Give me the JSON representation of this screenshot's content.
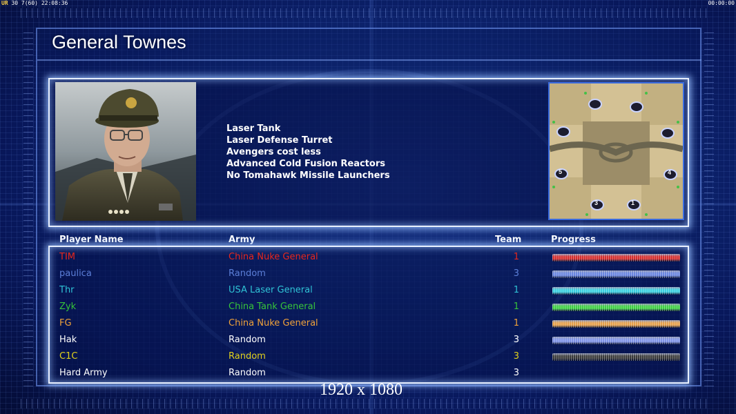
{
  "hud": {
    "left_label": "UR",
    "left_stats": "30 7(60) 22:08:36",
    "right_clock": "00:00:00"
  },
  "general": {
    "title": "General Townes",
    "features": [
      "Laser Tank",
      "Laser Defense Turret",
      "Avengers cost less",
      "Advanced Cold Fusion Reactors",
      "No Tomahawk Missile Launchers"
    ]
  },
  "minimap": {
    "start_positions": [
      "5",
      "4",
      "3",
      "1"
    ]
  },
  "table": {
    "headers": {
      "player_name": "Player Name",
      "army": "Army",
      "team": "Team",
      "progress": "Progress"
    },
    "rows": [
      {
        "name": "TIM",
        "army": "China Nuke General",
        "team": "1",
        "color": "#e8271c",
        "army_color": "#e8271c",
        "team_color": "#e8271c",
        "bar_color": "#d62d2d",
        "has_bar": true
      },
      {
        "name": "paulica",
        "army": "Random",
        "team": "3",
        "color": "#5c7fd8",
        "army_color": "#5c7fd8",
        "team_color": "#5c7fd8",
        "bar_color": "#6a86e0",
        "has_bar": true
      },
      {
        "name": "Thr",
        "army": "USA Laser General",
        "team": "1",
        "color": "#2fc3d6",
        "army_color": "#2fc3d6",
        "team_color": "#2fc3d6",
        "bar_color": "#3ad0e0",
        "has_bar": true
      },
      {
        "name": "Zyk",
        "army": "China Tank General",
        "team": "1",
        "color": "#37c53a",
        "army_color": "#37c53a",
        "team_color": "#37c53a",
        "bar_color": "#3fd043",
        "has_bar": true
      },
      {
        "name": "FG",
        "army": "China Nuke General",
        "team": "1",
        "color": "#f0a23a",
        "army_color": "#f0a23a",
        "team_color": "#f0a23a",
        "bar_color": "#e6a04a",
        "has_bar": true
      },
      {
        "name": "Hak",
        "army": "Random",
        "team": "3",
        "color": "#ffffff",
        "army_color": "#ffffff",
        "team_color": "#ffffff",
        "bar_color": "#7f93e8",
        "has_bar": true
      },
      {
        "name": "C1C",
        "army": "Random",
        "team": "3",
        "color": "#e2d21c",
        "army_color": "#e2d21c",
        "team_color": "#e2d21c",
        "bar_color": "#3a3a3a",
        "has_bar": true
      },
      {
        "name": "Hard Army",
        "army": "Random",
        "team": "3",
        "color": "#ffffff",
        "army_color": "#ffffff",
        "team_color": "#ffffff",
        "bar_color": "",
        "has_bar": false
      }
    ]
  },
  "caption": "1920 x 1080"
}
